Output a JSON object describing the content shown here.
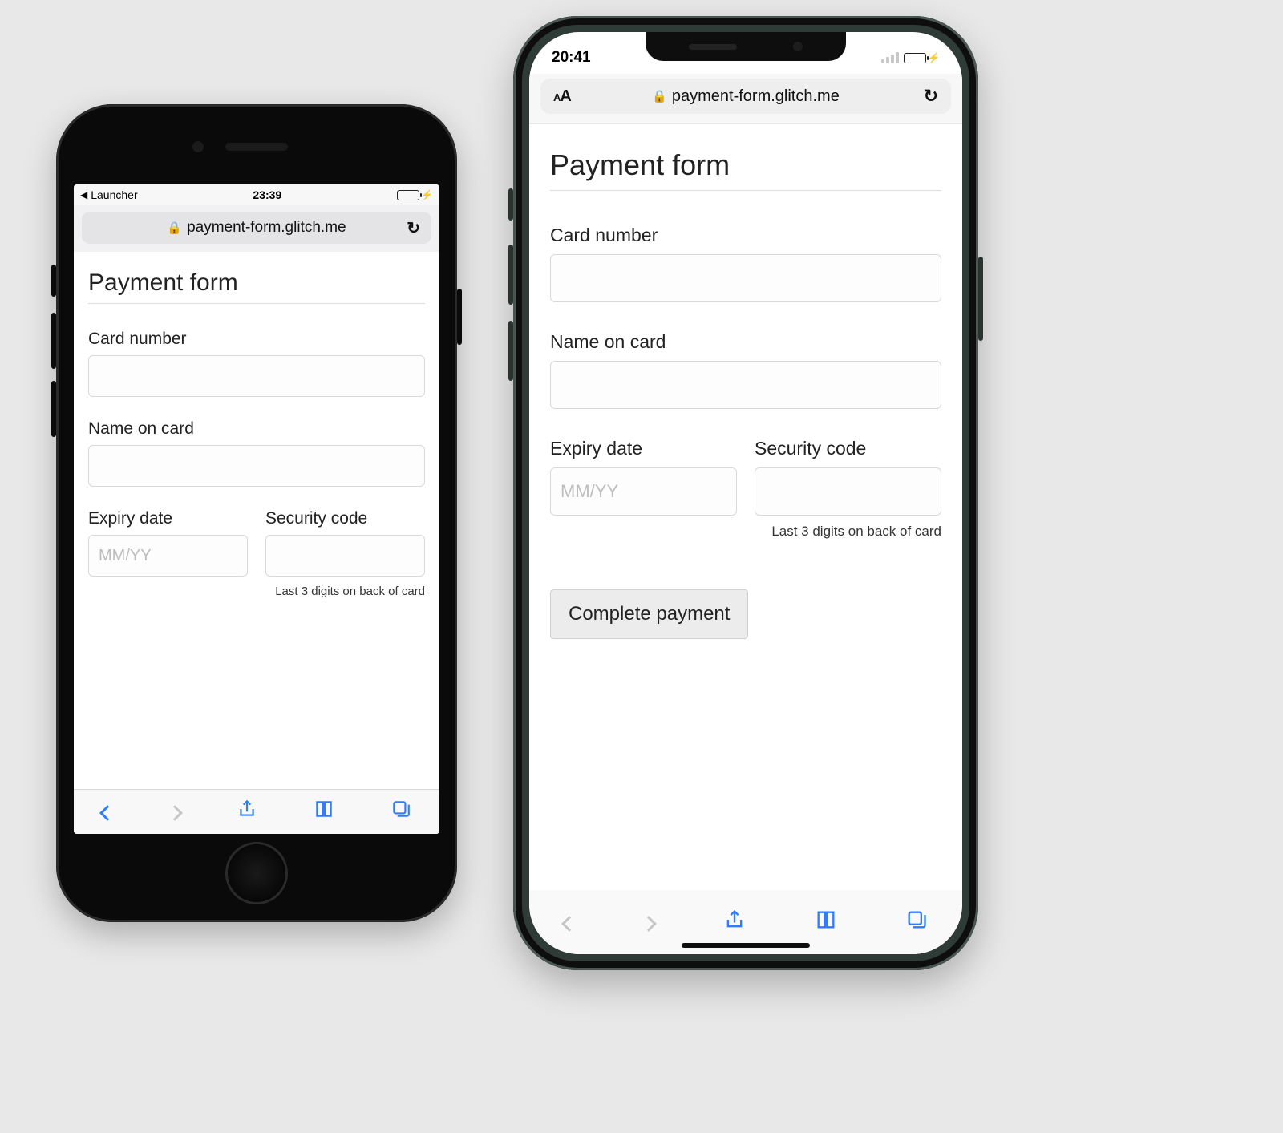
{
  "left": {
    "status": {
      "back_app": "Launcher",
      "time": "23:39"
    },
    "url": "payment-form.glitch.me",
    "page": {
      "title": "Payment form",
      "card_number_label": "Card number",
      "name_label": "Name on card",
      "expiry_label": "Expiry date",
      "expiry_placeholder": "MM/YY",
      "cvc_label": "Security code",
      "cvc_hint": "Last 3 digits on back of card"
    }
  },
  "right": {
    "status": {
      "time": "20:41"
    },
    "url_aa": "AA",
    "url": "payment-form.glitch.me",
    "page": {
      "title": "Payment form",
      "card_number_label": "Card number",
      "name_label": "Name on card",
      "expiry_label": "Expiry date",
      "expiry_placeholder": "MM/YY",
      "cvc_label": "Security code",
      "cvc_hint": "Last 3 digits on back of card",
      "submit_label": "Complete payment"
    }
  }
}
